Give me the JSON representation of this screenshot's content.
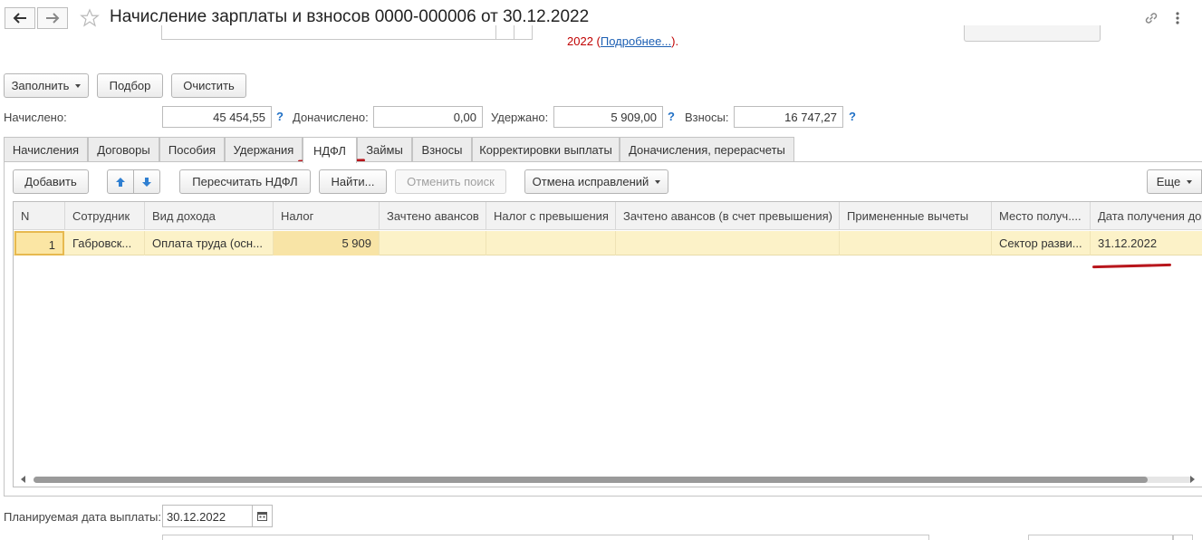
{
  "window": {
    "title": "Начисление зарплаты и взносов 0000-000006 от 30.12.2022",
    "back_icon": "arrow-left",
    "forward_icon": "arrow-right",
    "favorite_icon": "star",
    "link_icon": "link",
    "more_icon": "vertical-dots"
  },
  "notice": {
    "prefix": "2022 (",
    "link": "Подробнее...",
    "suffix": ")."
  },
  "toolbar": {
    "fill_label": "Заполнить",
    "select_label": "Подбор",
    "clear_label": "Очистить"
  },
  "totals": {
    "accrued_label": "Начислено:",
    "accrued_value": "45 454,55",
    "additional_label": "Доначислено:",
    "additional_value": "0,00",
    "withheld_label": "Удержано:",
    "withheld_value": "5 909,00",
    "contributions_label": "Взносы:",
    "contributions_value": "16 747,27",
    "help": "?"
  },
  "tabs": [
    {
      "label": "Начисления"
    },
    {
      "label": "Договоры"
    },
    {
      "label": "Пособия"
    },
    {
      "label": "Удержания"
    },
    {
      "label": "НДФЛ",
      "active": true
    },
    {
      "label": "Займы"
    },
    {
      "label": "Взносы"
    },
    {
      "label": "Корректировки выплаты"
    },
    {
      "label": "Доначисления, перерасчеты"
    }
  ],
  "tab_toolbar": {
    "add_label": "Добавить",
    "recalc_label": "Пересчитать НДФЛ",
    "find_label": "Найти...",
    "cancel_search_label": "Отменить поиск",
    "cancel_corrections_label": "Отмена исправлений",
    "more_label": "Еще"
  },
  "table": {
    "columns": [
      "N",
      "Сотрудник",
      "Вид дохода",
      "Налог",
      "Зачтено авансов",
      "Налог с превышения",
      "Зачтено авансов (в счет превышения)",
      "Примененные вычеты",
      "Место получ....",
      "Дата получения до"
    ],
    "rows": [
      [
        "1",
        "Габровск...",
        "Оплата труда (осн...",
        "5 909",
        "",
        "",
        "",
        "",
        "Сектор разви...",
        "31.12.2022"
      ]
    ]
  },
  "footer": {
    "planned_date_label": "Планируемая дата выплаты:",
    "planned_date_value": "30.12.2022"
  },
  "colors": {
    "selected_row": "#fcf2c8",
    "annotation_red": "#b8161c",
    "accent_blue": "#1f6fc5"
  }
}
